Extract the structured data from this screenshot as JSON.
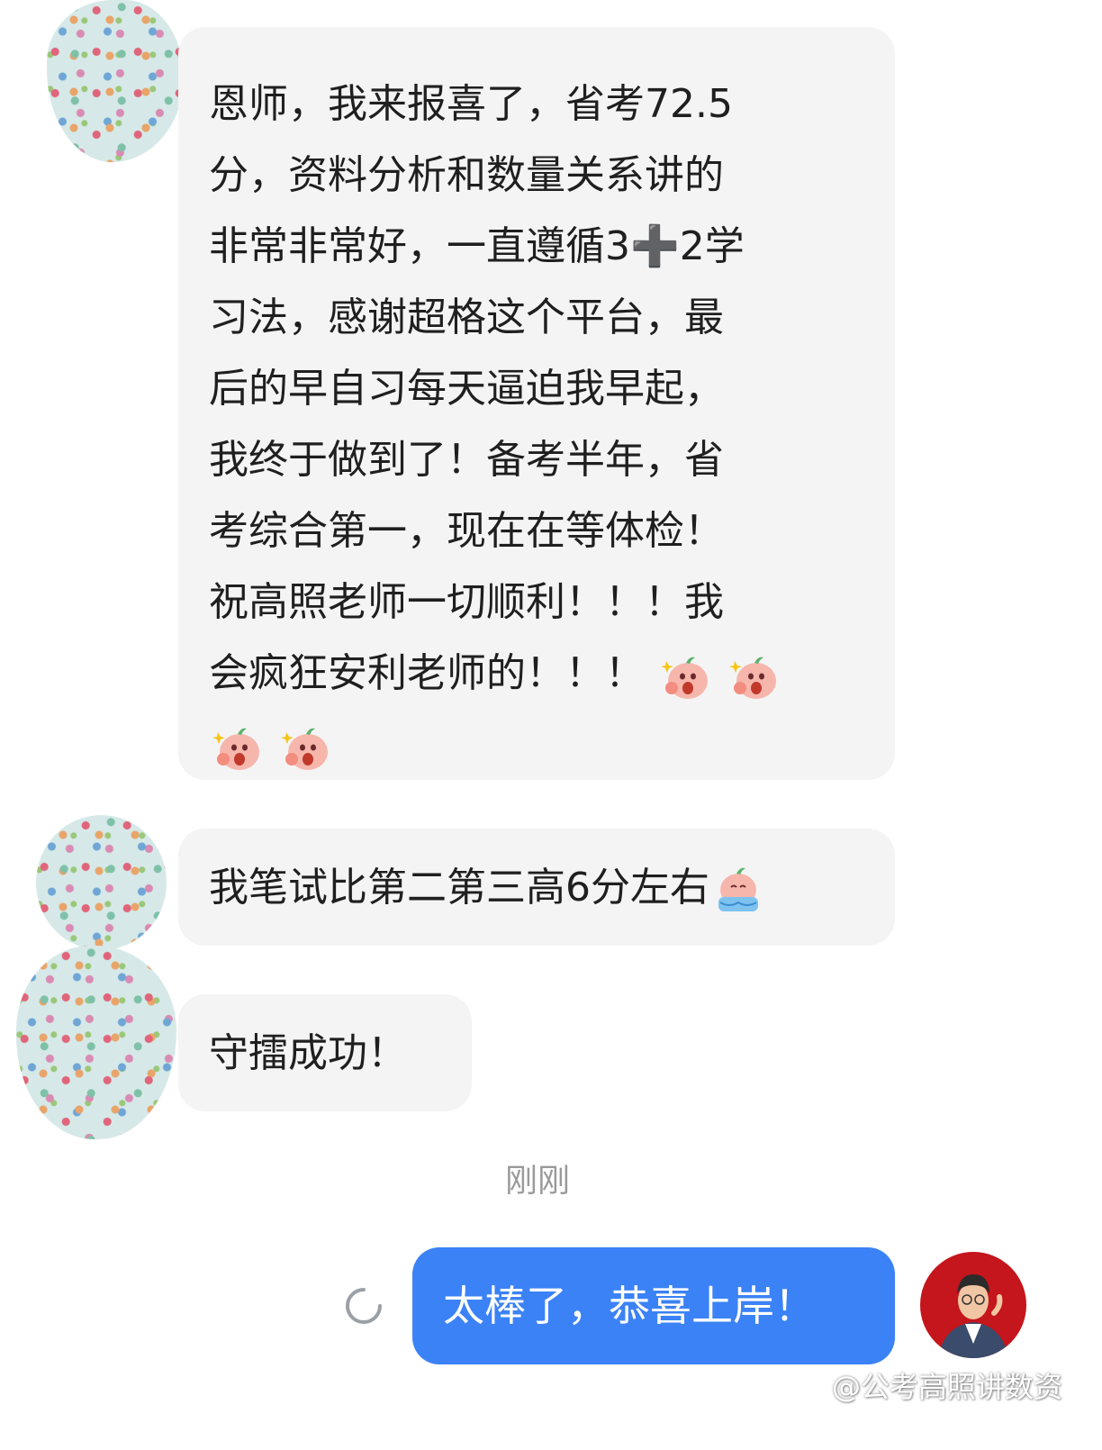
{
  "messages": {
    "first": {
      "lines": [
        "恩师，我来报喜了，省考72.5",
        "分，资料分析和数量关系讲的",
        "非常非常好，一直遵循3➕2学",
        "习法，感谢超格这个平台，最",
        "后的早自习每天逼迫我早起，",
        "我终于做到了！备考半年，省",
        "考综合第一，现在在等体检！",
        "祝高照老师一切顺利！！！我",
        "会疯狂安利老师的！！！"
      ]
    },
    "second": {
      "text": "我笔试比第二第三高6分左右"
    },
    "third": {
      "text": "守擂成功！"
    }
  },
  "timestamp": "刚刚",
  "sent_message": {
    "text": "太棒了，恭喜上岸！"
  },
  "watermark": {
    "text": "@公考高照讲数资",
    "icon": "weibo-icon"
  },
  "colors": {
    "received_bubble": "#f4f4f5",
    "sent_bubble": "#3b82f6",
    "timestamp": "#9a9a9a"
  }
}
